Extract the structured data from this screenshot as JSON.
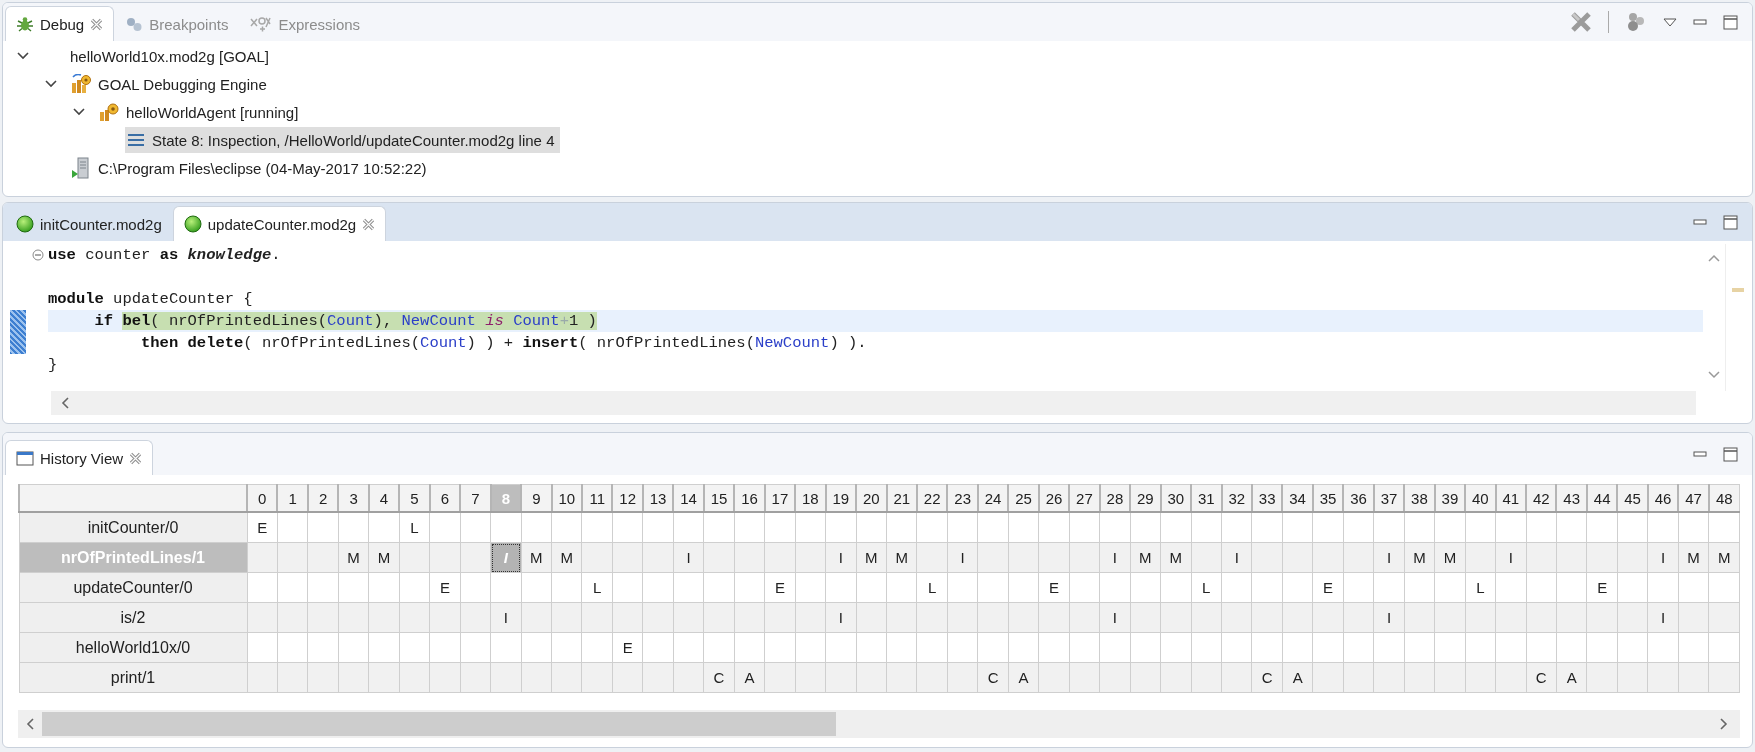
{
  "debug_view": {
    "tabs": [
      {
        "label": "Debug",
        "kind": "debug",
        "selected": true
      },
      {
        "label": "Breakpoints",
        "kind": "breakpoints",
        "selected": false
      },
      {
        "label": "Expressions",
        "kind": "expressions",
        "selected": false
      }
    ],
    "tree": [
      {
        "label": "helloWorld10x.mod2g [GOAL]",
        "selected": false,
        "expanded": true,
        "children": [
          {
            "label": "GOAL Debugging Engine",
            "kind": "engine",
            "selected": false,
            "expanded": true,
            "children": [
              {
                "label": "helloWorldAgent [running]",
                "kind": "agent",
                "selected": false,
                "expanded": true,
                "children": [
                  {
                    "label": "State 8: Inspection, /HelloWorld/updateCounter.mod2g line 4",
                    "kind": "frame",
                    "selected": true
                  }
                ]
              }
            ]
          },
          {
            "label": "C:\\Program Files\\eclipse (04-May-2017 10:52:22)",
            "kind": "process",
            "selected": false
          }
        ]
      }
    ]
  },
  "editor": {
    "tabs": [
      {
        "label": "initCounter.mod2g",
        "selected": false
      },
      {
        "label": "updateCounter.mod2g",
        "selected": true
      }
    ],
    "lines": [
      {
        "current": false,
        "foldable": true,
        "segments": [
          {
            "text": "use",
            "kind": "keyword"
          },
          {
            "text": " counter ",
            "kind": "plain"
          },
          {
            "text": "as",
            "kind": "keyword"
          },
          {
            "text": " knowledge",
            "kind": "emphasis"
          },
          {
            "text": ".",
            "kind": "plain"
          }
        ]
      },
      {
        "current": false,
        "foldable": false
      },
      {
        "current": false,
        "foldable": false,
        "segments": [
          {
            "text": "module",
            "kind": "keyword"
          },
          {
            "text": " updateCounter {",
            "kind": "plain"
          }
        ]
      },
      {
        "current": true,
        "foldable": false,
        "segments": [
          {
            "text": "     if ",
            "kind": "keyword"
          }
        ],
        "highlight": [
          {
            "text": "bel",
            "kind": "keyword"
          },
          {
            "text": "( nrOfPrintedLines(",
            "kind": "plain"
          },
          {
            "text": "Count",
            "kind": "variable"
          },
          {
            "text": "), ",
            "kind": "plain"
          },
          {
            "text": "NewCount",
            "kind": "variable"
          },
          {
            "text": " is ",
            "kind": "operator"
          },
          {
            "text": "Count",
            "kind": "variable"
          },
          {
            "text": "+",
            "kind": "faint"
          },
          {
            "text": "1 )",
            "kind": "plain"
          }
        ]
      },
      {
        "current": false,
        "foldable": false,
        "segments": [
          {
            "text": "          then delete",
            "kind": "keyword"
          },
          {
            "text": "( nrOfPrintedLines(",
            "kind": "plain"
          },
          {
            "text": "Count",
            "kind": "variable"
          },
          {
            "text": ") ) + ",
            "kind": "plain"
          },
          {
            "text": "insert",
            "kind": "keyword"
          },
          {
            "text": "( nrOfPrintedLines(",
            "kind": "plain"
          },
          {
            "text": "NewCount",
            "kind": "variable"
          },
          {
            "text": ") ).",
            "kind": "plain"
          }
        ]
      },
      {
        "current": false,
        "foldable": false,
        "segments": [
          {
            "text": "}",
            "kind": "plain"
          }
        ]
      }
    ]
  },
  "history_view": {
    "title": "History View",
    "columns": [
      {
        "label": "0",
        "selected": false
      },
      {
        "label": "1",
        "selected": false
      },
      {
        "label": "2",
        "selected": false
      },
      {
        "label": "3",
        "selected": false
      },
      {
        "label": "4",
        "selected": false
      },
      {
        "label": "5",
        "selected": false
      },
      {
        "label": "6",
        "selected": false
      },
      {
        "label": "7",
        "selected": false
      },
      {
        "label": "8",
        "selected": true
      },
      {
        "label": "9",
        "selected": false
      },
      {
        "label": "10",
        "selected": false
      },
      {
        "label": "11",
        "selected": false
      },
      {
        "label": "12",
        "selected": false
      },
      {
        "label": "13",
        "selected": false
      },
      {
        "label": "14",
        "selected": false
      },
      {
        "label": "15",
        "selected": false
      },
      {
        "label": "16",
        "selected": false
      },
      {
        "label": "17",
        "selected": false
      },
      {
        "label": "18",
        "selected": false
      },
      {
        "label": "19",
        "selected": false
      },
      {
        "label": "20",
        "selected": false
      },
      {
        "label": "21",
        "selected": false
      },
      {
        "label": "22",
        "selected": false
      },
      {
        "label": "23",
        "selected": false
      },
      {
        "label": "24",
        "selected": false
      },
      {
        "label": "25",
        "selected": false
      },
      {
        "label": "26",
        "selected": false
      },
      {
        "label": "27",
        "selected": false
      },
      {
        "label": "28",
        "selected": false
      },
      {
        "label": "29",
        "selected": false
      },
      {
        "label": "30",
        "selected": false
      },
      {
        "label": "31",
        "selected": false
      },
      {
        "label": "32",
        "selected": false
      },
      {
        "label": "33",
        "selected": false
      },
      {
        "label": "34",
        "selected": false
      },
      {
        "label": "35",
        "selected": false
      },
      {
        "label": "36",
        "selected": false
      },
      {
        "label": "37",
        "selected": false
      },
      {
        "label": "38",
        "selected": false
      },
      {
        "label": "39",
        "selected": false
      },
      {
        "label": "40",
        "selected": false
      },
      {
        "label": "41",
        "selected": false
      },
      {
        "label": "42",
        "selected": false
      },
      {
        "label": "43",
        "selected": false
      },
      {
        "label": "44",
        "selected": false
      },
      {
        "label": "45",
        "selected": false
      },
      {
        "label": "46",
        "selected": false
      },
      {
        "label": "47",
        "selected": false
      },
      {
        "label": "48",
        "selected": false
      }
    ],
    "rows": [
      {
        "label": "initCounter/0",
        "selected": false,
        "cells": [
          "E",
          null,
          null,
          null,
          null,
          "L",
          null,
          null,
          null,
          null,
          null,
          null,
          null,
          null,
          null,
          null,
          null,
          null,
          null,
          null,
          null,
          null,
          null,
          null,
          null,
          null,
          null,
          null,
          null,
          null,
          null,
          null,
          null,
          null,
          null,
          null,
          null,
          null,
          null,
          null,
          null,
          null,
          null,
          null,
          null,
          null,
          null,
          null,
          null
        ]
      },
      {
        "label": "nrOfPrintedLines/1",
        "selected": true,
        "cells": [
          null,
          null,
          null,
          "M",
          "M",
          null,
          null,
          null,
          "I",
          "M",
          "M",
          null,
          null,
          null,
          "I",
          null,
          null,
          null,
          null,
          "I",
          "M",
          "M",
          null,
          "I",
          null,
          null,
          null,
          null,
          "I",
          "M",
          "M",
          null,
          "I",
          null,
          null,
          null,
          null,
          "I",
          "M",
          "M",
          null,
          "I",
          null,
          null,
          null,
          null,
          "I",
          "M",
          "M"
        ]
      },
      {
        "label": "updateCounter/0",
        "selected": false,
        "cells": [
          null,
          null,
          null,
          null,
          null,
          null,
          "E",
          null,
          null,
          null,
          null,
          "L",
          null,
          null,
          null,
          null,
          null,
          "E",
          null,
          null,
          null,
          null,
          "L",
          null,
          null,
          null,
          "E",
          null,
          null,
          null,
          null,
          "L",
          null,
          null,
          null,
          "E",
          null,
          null,
          null,
          null,
          "L",
          null,
          null,
          null,
          "E",
          null,
          null,
          null,
          null
        ]
      },
      {
        "label": "is/2",
        "selected": false,
        "cells": [
          null,
          null,
          null,
          null,
          null,
          null,
          null,
          null,
          "I",
          null,
          null,
          null,
          null,
          null,
          null,
          null,
          null,
          null,
          null,
          "I",
          null,
          null,
          null,
          null,
          null,
          null,
          null,
          null,
          "I",
          null,
          null,
          null,
          null,
          null,
          null,
          null,
          null,
          "I",
          null,
          null,
          null,
          null,
          null,
          null,
          null,
          null,
          "I",
          null,
          null
        ]
      },
      {
        "label": "helloWorld10x/0",
        "selected": false,
        "cells": [
          null,
          null,
          null,
          null,
          null,
          null,
          null,
          null,
          null,
          null,
          null,
          null,
          "E",
          null,
          null,
          null,
          null,
          null,
          null,
          null,
          null,
          null,
          null,
          null,
          null,
          null,
          null,
          null,
          null,
          null,
          null,
          null,
          null,
          null,
          null,
          null,
          null,
          null,
          null,
          null,
          null,
          null,
          null,
          null,
          null,
          null,
          null,
          null,
          null
        ]
      },
      {
        "label": "print/1",
        "selected": false,
        "cells": [
          null,
          null,
          null,
          null,
          null,
          null,
          null,
          null,
          null,
          null,
          null,
          null,
          null,
          null,
          null,
          "C",
          "A",
          null,
          null,
          null,
          null,
          null,
          null,
          null,
          "C",
          "A",
          null,
          null,
          null,
          null,
          null,
          null,
          null,
          "C",
          "A",
          null,
          null,
          null,
          null,
          null,
          null,
          null,
          "C",
          "A",
          null,
          null,
          null,
          null,
          null
        ]
      }
    ]
  }
}
